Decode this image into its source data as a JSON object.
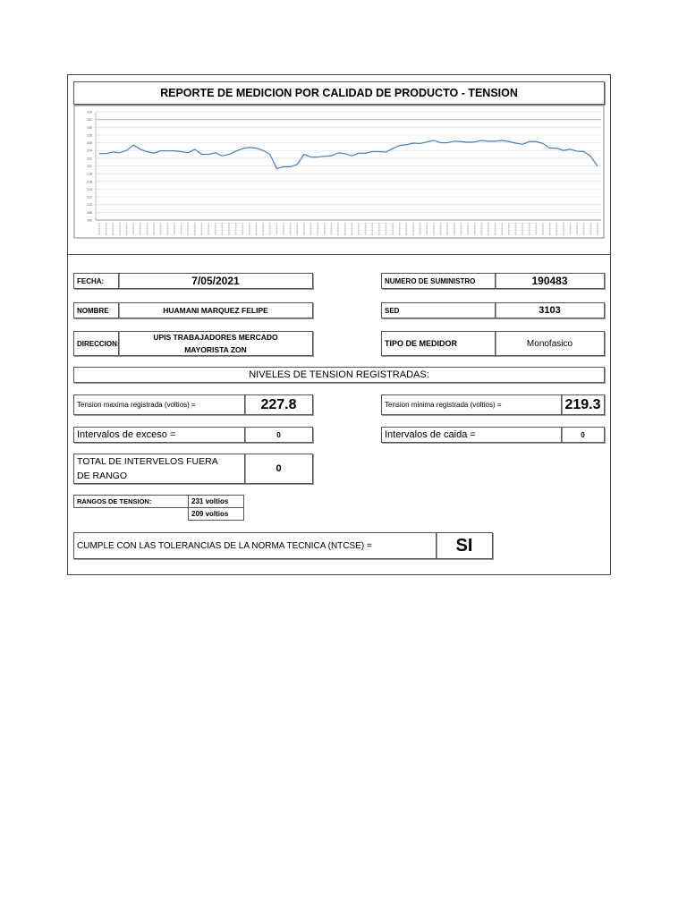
{
  "report": {
    "title": "REPORTE DE MEDICION POR CALIDAD DE PRODUCTO - TENSION",
    "fecha_label": "FECHA:",
    "fecha": "7/05/2021",
    "suministro_label": "NUMERO DE SUMINISTRO",
    "suministro": "190483",
    "nombre_label": "NOMBRE",
    "nombre": "HUAMANI MARQUEZ FELIPE",
    "sed_label": "SED",
    "sed": "3103",
    "direccion_label": "DIRECCION:",
    "direccion": "UPIS TRABAJADORES MERCADO MAYORISTA ZON",
    "medidor_label": "TIPO DE MEDIDOR",
    "medidor": "Monofasico",
    "niveles_title": "NIVELES DE TENSION REGISTRADAS:",
    "tmax_label": "Tension maxima registrada (voltios) =",
    "tmax": "227.8",
    "tmin_label": "Tension minima registrada (voltios) =",
    "tmin": "219.3",
    "exceso_label": "Intervalos de exceso =",
    "exceso": "0",
    "caida_label": "Intervalos de caida =",
    "caida": "0",
    "total_label": "TOTAL DE INTERVELOS FUERA DE RANGO",
    "total": "0",
    "rangos_label": "RANGOS DE TENSION:",
    "rango_max": "231 voltios",
    "rango_min": "209 voltios",
    "cumple_label": "CUMPLE CON LAS TOLERANCIAS DE LA NORMA TECNICA (NTCSE) =",
    "cumple": "SI"
  },
  "chart_data": {
    "type": "line",
    "title": "REPORTE DE MEDICION POR CALIDAD DE PRODUCTO - TENSION",
    "ylim": [
      206,
      234
    ],
    "yticks": [
      206,
      208,
      210,
      212,
      214,
      216,
      218,
      220,
      222,
      224,
      226,
      228,
      230,
      232,
      234
    ],
    "grid": true,
    "line_color": "#4a7ebb",
    "values": [
      223.2,
      223.2,
      223.6,
      223.4,
      224,
      225.4,
      224.3,
      223.7,
      223.3,
      223.9,
      223.9,
      223.9,
      223.7,
      223.4,
      224.3,
      223,
      223,
      223.4,
      222.6,
      223,
      223.8,
      224.5,
      224.8,
      224.6,
      224,
      223,
      219.3,
      219.8,
      219.8,
      220.4,
      223,
      222.3,
      222.3,
      222.5,
      222.6,
      223.4,
      223.2,
      222.6,
      223.3,
      223.3,
      223.7,
      223.7,
      223.6,
      224.5,
      225.3,
      225.5,
      225.9,
      225.8,
      226.2,
      226.6,
      226,
      226,
      226.4,
      226.3,
      226.1,
      226.2,
      226.6,
      226.4,
      226.4,
      226.6,
      226.3,
      225.9,
      225.6,
      226.3,
      226.3,
      225.8,
      224.6,
      224.6,
      224,
      224.3,
      223.8,
      223.7,
      222.5,
      219.9
    ]
  }
}
